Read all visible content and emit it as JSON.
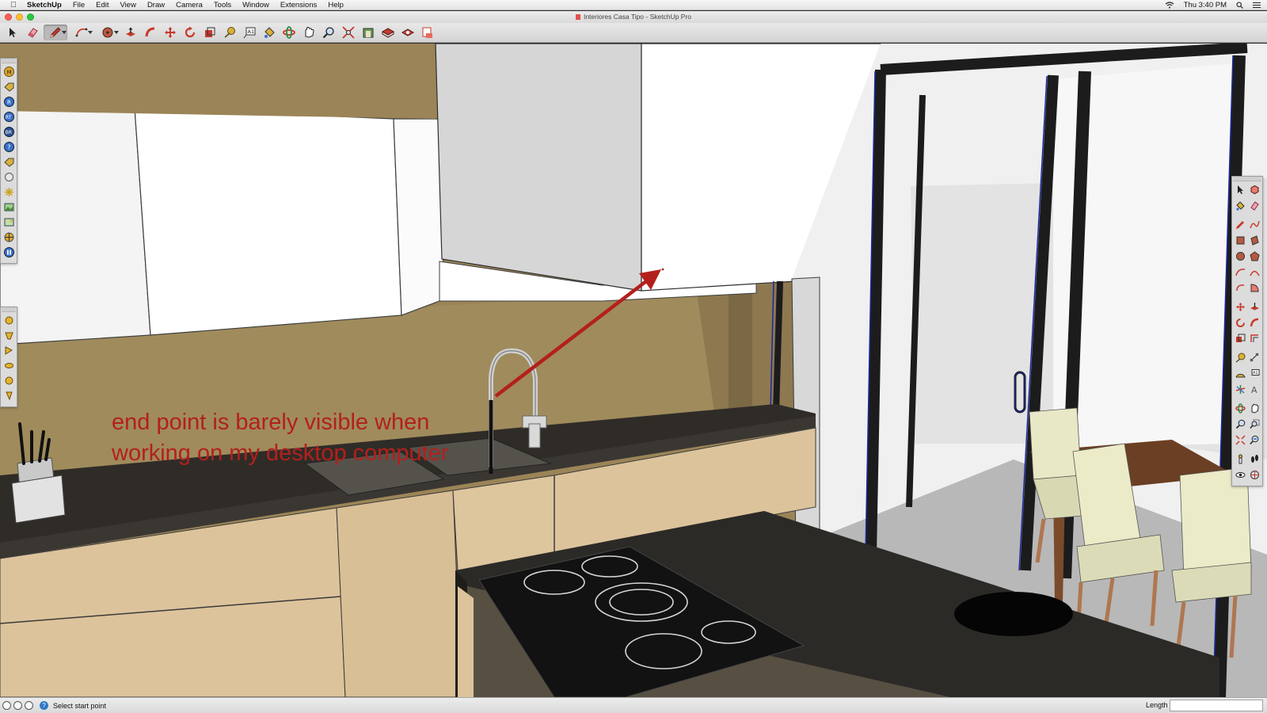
{
  "menubar": {
    "app_name": "SketchUp",
    "items": [
      "File",
      "Edit",
      "View",
      "Draw",
      "Camera",
      "Tools",
      "Window",
      "Extensions",
      "Help"
    ],
    "clock": "Thu 3:40 PM"
  },
  "window": {
    "title": "Interiores Casa Tipo - SketchUp Pro"
  },
  "toolbar": {
    "tools": [
      "select-icon",
      "eraser-icon",
      "pencil-icon",
      "arc-icon",
      "circle-icon",
      "push-pull-icon",
      "follow-me-icon",
      "move-icon",
      "rotate-icon",
      "scale-icon",
      "tape-measure-icon",
      "text-icon",
      "paint-bucket-icon",
      "orbit-icon",
      "pan-icon",
      "zoom-icon",
      "zoom-extents-icon",
      "section-plane-icon",
      "warehouse-icon",
      "extension-warehouse-icon",
      "layout-icon"
    ],
    "active_tool": "pencil-icon"
  },
  "annotation": {
    "line1": "end point is barely visible when",
    "line2": "working on my desktop computer",
    "color": "#b3201c"
  },
  "statusbar": {
    "hint": "Select start point",
    "measurement_label": "Length",
    "measurement_value": ""
  },
  "colors": {
    "wall_paint": "#9b8457",
    "countertop": "#2f2c28",
    "cabinet_wood": "#dcc39b",
    "annotation_red": "#b3201c",
    "edge_blue": "#1a2aa0"
  }
}
